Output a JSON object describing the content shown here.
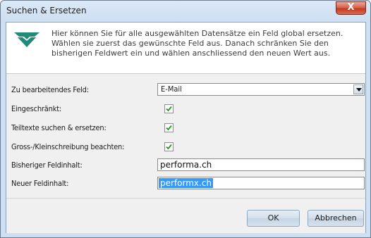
{
  "window": {
    "title": "Suchen & Ersetzen",
    "close_glyph": "X"
  },
  "header": {
    "description": "Hier können Sie für alle ausgewählten Datensätze ein Feld global ersetzen. Wählen sie zuerst das gewünschte Feld aus. Danach schränken Sie den bisherigen Feldwert ein und wählen anschliessend den neuen Wert aus.",
    "logo_icon": "brand-logo-icon",
    "logo_color": "#1e8c76"
  },
  "form": {
    "field_label": "Zu bearbeitendes Feld:",
    "field_value": "E-Mail",
    "restricted_label": "Eingeschränkt:",
    "restricted_checked": true,
    "partial_label": "Teiltexte suchen & ersetzen:",
    "partial_checked": true,
    "case_label": "Gross-/Kleinschreibung beachten:",
    "case_checked": true,
    "old_value_label": "Bisheriger Feldinhalt:",
    "old_value": "performa.ch",
    "new_value_label": "Neuer Feldinhalt:",
    "new_value": "performx.ch"
  },
  "buttons": {
    "ok": "OK",
    "cancel": "Abbrechen"
  },
  "colors": {
    "check_green": "#2d8f2d",
    "selection_blue": "#3399ff",
    "close_red": "#c4391f"
  }
}
